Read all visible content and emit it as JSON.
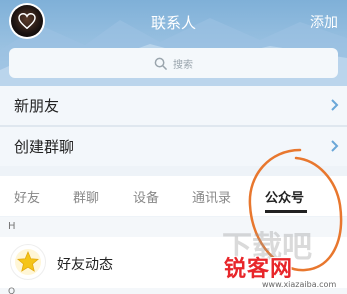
{
  "header": {
    "title": "联系人",
    "add_label": "添加"
  },
  "search": {
    "placeholder": "搜索",
    "icon": "search-icon"
  },
  "rows": {
    "new_friend": "新朋友",
    "create_group": "创建群聊"
  },
  "tabs": [
    {
      "label": "好友",
      "active": false
    },
    {
      "label": "群聊",
      "active": false
    },
    {
      "label": "设备",
      "active": false
    },
    {
      "label": "通讯录",
      "active": false
    },
    {
      "label": "公众号",
      "active": true
    }
  ],
  "section_letter": "H",
  "friend_item": {
    "label": "好友动态",
    "icon": "star-icon"
  },
  "next_section_letter": "Q",
  "watermark": {
    "brand": "锐客网",
    "logo_text": "下载吧",
    "url": "www.xiazaiba.com"
  },
  "colors": {
    "annotation_circle": "#e8772e",
    "star": "#f5c518",
    "chevron": "#6aa7d8"
  }
}
